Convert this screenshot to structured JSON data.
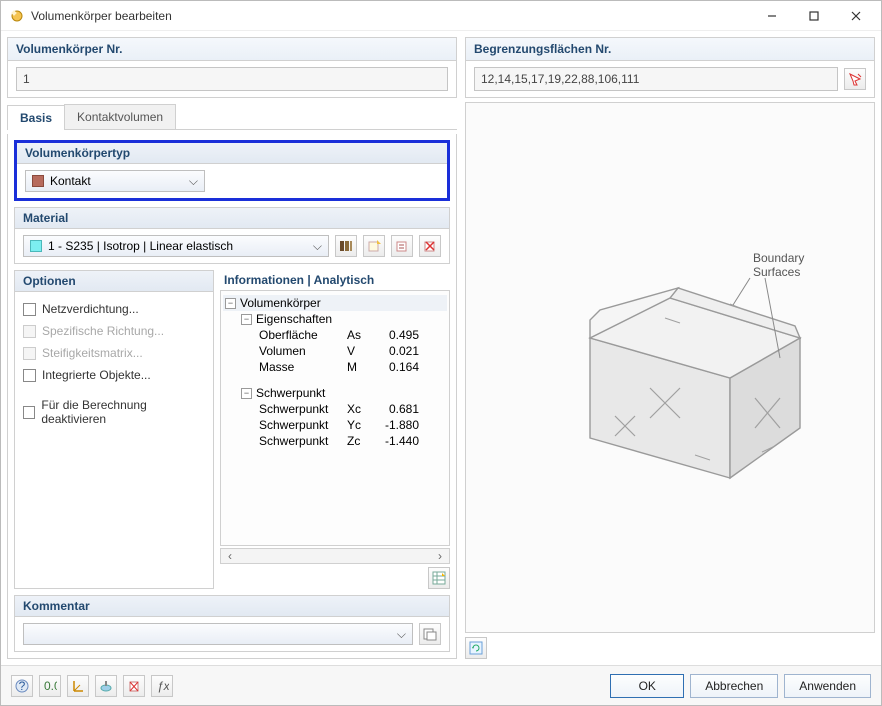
{
  "window": {
    "title": "Volumenkörper bearbeiten"
  },
  "solid_no": {
    "label": "Volumenkörper Nr.",
    "value": "1"
  },
  "surfaces": {
    "label": "Begrenzungsflächen Nr.",
    "value": "12,14,15,17,19,22,88,106,111"
  },
  "tabs": {
    "basis": "Basis",
    "contact": "Kontaktvolumen"
  },
  "type": {
    "label": "Volumenkörpertyp",
    "value": "Kontakt"
  },
  "material": {
    "label": "Material",
    "value": "1 - S235 | Isotrop | Linear elastisch"
  },
  "options": {
    "label": "Optionen",
    "mesh": "Netzverdichtung...",
    "dir": "Spezifische Richtung...",
    "stiff": "Steifigkeitsmatrix...",
    "objects": "Integrierte Objekte...",
    "deact": "Für die Berechnung deaktivieren"
  },
  "info": {
    "label": "Informationen | Analytisch",
    "root": "Volumenkörper",
    "props": "Eigenschaften",
    "surface": "Oberfläche",
    "surface_sym": "As",
    "surface_val": "0.495",
    "volume": "Volumen",
    "volume_sym": "V",
    "volume_val": "0.021",
    "mass": "Masse",
    "mass_sym": "M",
    "mass_val": "0.164",
    "centroid": "Schwerpunkt",
    "cx": "Schwerpunkt",
    "cx_sym": "Xc",
    "cx_val": "0.681",
    "cy": "Schwerpunkt",
    "cy_sym": "Yc",
    "cy_val": "-1.880",
    "cz": "Schwerpunkt",
    "cz_sym": "Zc",
    "cz_val": "-1.440"
  },
  "comment": {
    "label": "Kommentar",
    "value": ""
  },
  "preview": {
    "label": "Boundary\nSurfaces"
  },
  "buttons": {
    "ok": "OK",
    "cancel": "Abbrechen",
    "apply": "Anwenden"
  }
}
